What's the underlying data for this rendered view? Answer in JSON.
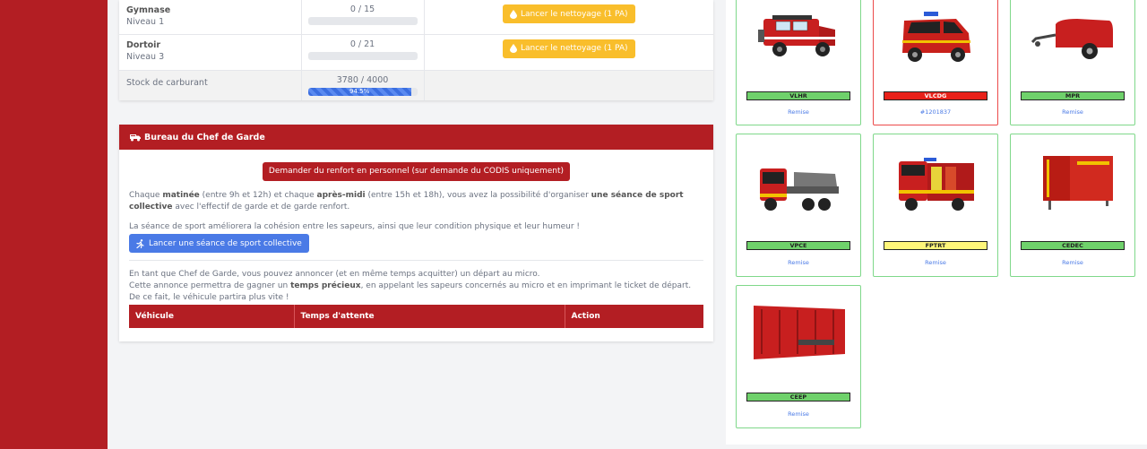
{
  "resources": {
    "rows": [
      {
        "name": "Gymnase",
        "level": "Niveau 1",
        "count": "0 / 15",
        "action": "Lancer le nettoyage (1 PA)",
        "progress": 0
      },
      {
        "name": "Dortoir",
        "level": "Niveau 3",
        "count": "0 / 21",
        "action": "Lancer le nettoyage (1 PA)",
        "progress": 0
      }
    ],
    "fuel": {
      "label": "Stock de carburant",
      "count": "3780 / 4000",
      "percent": "94.5%",
      "progress": 0.945
    }
  },
  "bureau": {
    "title": "Bureau du Chef de Garde",
    "renfort_button": "Demander du renfort en personnel (sur demande du CODIS uniquement)",
    "p1_a": "Chaque ",
    "p1_b": "matinée",
    "p1_c": " (entre 9h et 12h) et chaque ",
    "p1_d": "après-midi",
    "p1_e": " (entre 15h et 18h), vous avez la possibilité d'organiser ",
    "p1_f": "une séance de sport collective",
    "p1_g": " avec l'effectif de garde et de garde renfort.",
    "p2": "La séance de sport améliorera la cohésion entre les sapeurs, ainsi que leur condition physique et leur humeur !",
    "sport_button": "Lancer une séance de sport collective",
    "p3": "En tant que Chef de Garde, vous pouvez annoncer (et en même temps acquitter) un départ au micro.",
    "p4_a": "Cette annonce permettra de gagner un ",
    "p4_b": "temps précieux",
    "p4_c": ", en appelant les sapeurs concernés au micro et en imprimant le ticket de départ. De ce fait, le véhicule partira plus vite !",
    "table_headers": [
      "Véhicule",
      "Temps d'attente",
      "Action"
    ]
  },
  "vehicles": [
    {
      "name": "VLHR",
      "status": "Remise",
      "label_color": "#6fd16b"
    },
    {
      "name": "VLCDG",
      "status": "#1201837",
      "label_color": "#e8211a"
    },
    {
      "name": "MPR",
      "status": "Remise",
      "label_color": "#6fd16b"
    },
    {
      "name": "VPCE",
      "status": "Remise",
      "label_color": "#6fd16b"
    },
    {
      "name": "FPTRT",
      "status": "Remise",
      "label_color": "#fff67a"
    },
    {
      "name": "CEDEC",
      "status": "Remise",
      "label_color": "#6fd16b"
    },
    {
      "name": "CEEP",
      "status": "Remise",
      "label_color": "#6fd16b"
    }
  ],
  "icons": {
    "drop": "water-drop-icon",
    "truck": "fire-truck-icon",
    "runner": "running-person-icon"
  }
}
